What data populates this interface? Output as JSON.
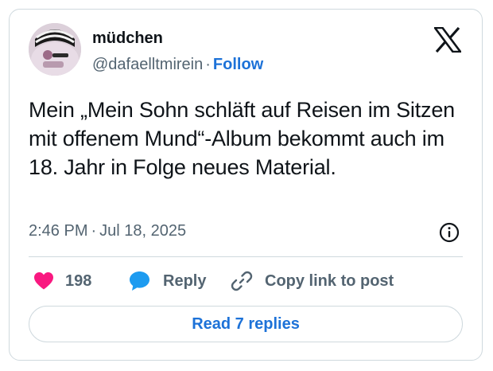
{
  "author": {
    "display_name": "müdchen",
    "handle": "@dafaelltmirein",
    "separator": "·",
    "follow_label": "Follow"
  },
  "brand": {
    "logo_icon": "x-logo-icon"
  },
  "tweet": {
    "text": "Mein „Mein Sohn schläft auf Reisen im Sitzen mit offenem Mund“-Album bekommt auch im 18. Jahr in Folge neues Material.",
    "time": "2:46 PM",
    "separator": "·",
    "date": "Jul 18, 2025",
    "info_icon": "info-icon"
  },
  "actions": {
    "like": {
      "icon": "heart-icon",
      "count": "198"
    },
    "reply": {
      "icon": "speech-bubble-icon",
      "label": "Reply"
    },
    "copy": {
      "icon": "link-icon",
      "label": "Copy link to post"
    }
  },
  "footer": {
    "read_replies_label": "Read 7 replies"
  },
  "colors": {
    "accent": "#1d72d8",
    "heart": "#f91880",
    "reply_bubble": "#1d9bf0",
    "text_primary": "#0f1419",
    "text_secondary": "#536471",
    "border": "#cfd9de"
  }
}
